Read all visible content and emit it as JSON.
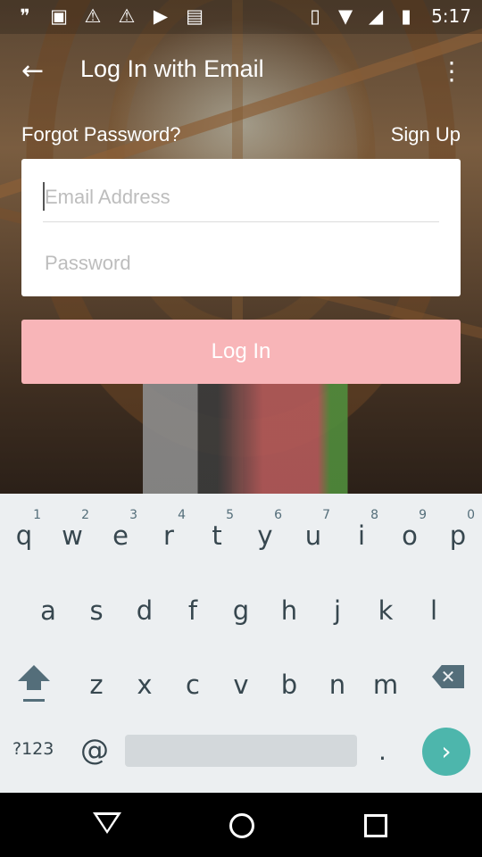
{
  "status_bar": {
    "time": "5:17",
    "icons": [
      "chat-icon",
      "image-icon",
      "warning-icon",
      "warning-icon",
      "youtube-icon",
      "briefcase-icon"
    ],
    "right_icons": [
      "vibrate-icon",
      "wifi-icon",
      "signal-icon",
      "battery-icon"
    ]
  },
  "app_bar": {
    "title": "Log In with Email",
    "back_icon": "back-arrow-icon",
    "overflow_icon": "more-vert-icon"
  },
  "links": {
    "forgot": "Forgot Password?",
    "signup": "Sign Up"
  },
  "form": {
    "email_placeholder": "Email Address",
    "email_value": "",
    "password_placeholder": "Password",
    "password_value": "",
    "login_label": "Log In",
    "login_color": "#f8b5b8"
  },
  "keyboard": {
    "row1": [
      {
        "ch": "q",
        "num": "1"
      },
      {
        "ch": "w",
        "num": "2"
      },
      {
        "ch": "e",
        "num": "3"
      },
      {
        "ch": "r",
        "num": "4"
      },
      {
        "ch": "t",
        "num": "5"
      },
      {
        "ch": "y",
        "num": "6"
      },
      {
        "ch": "u",
        "num": "7"
      },
      {
        "ch": "i",
        "num": "8"
      },
      {
        "ch": "o",
        "num": "9"
      },
      {
        "ch": "p",
        "num": "0"
      }
    ],
    "row2": [
      "a",
      "s",
      "d",
      "f",
      "g",
      "h",
      "j",
      "k",
      "l"
    ],
    "row3": [
      "z",
      "x",
      "c",
      "v",
      "b",
      "n",
      "m"
    ],
    "symbols_label": "?123",
    "at_label": "@",
    "period_label": ".",
    "go_icon": "chevron-right-icon",
    "go_color": "#4db6ac"
  },
  "nav_bar": {
    "icons": [
      "nav-back-icon",
      "nav-home-icon",
      "nav-recents-icon"
    ]
  }
}
